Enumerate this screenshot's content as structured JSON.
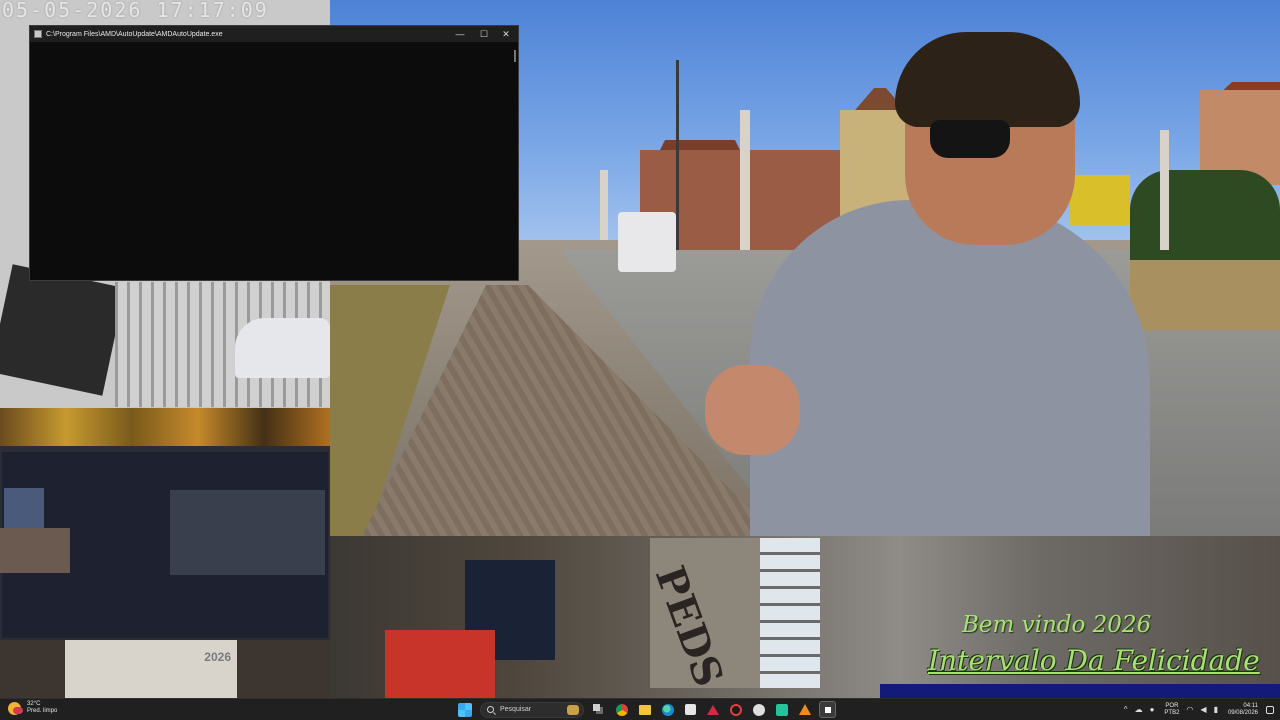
{
  "stream_overlay": {
    "timestamp": "05-05-2026  17:17:09",
    "caption_line1": "Bem vindo 2026",
    "caption_line2": "Intervalo Da Felicidade",
    "ticker": "",
    "calendar_year": "2026",
    "graffiti_text": "PEDS"
  },
  "console_window": {
    "title": "C:\\Program Files\\AMD\\AutoUpdate\\AMDAutoUpdate.exe",
    "minimize_glyph": "—",
    "maximize_glyph": "☐",
    "close_glyph": "✕"
  },
  "taskbar": {
    "weather": {
      "temperature": "32°C",
      "condition": "Pred. limpo"
    },
    "search_placeholder": "Pesquisar",
    "pinned_icons": [
      "start-icon",
      "search-icon",
      "task-view-icon",
      "chrome-icon",
      "file-explorer-icon",
      "edge-icon",
      "store-icon",
      "red-app-icon",
      "circle-app-icon",
      "gear-app-icon",
      "green-app-icon",
      "vlc-icon",
      "obs-icon"
    ],
    "tray": {
      "chevron": "^",
      "language": "POR",
      "keyboard": "PTB2",
      "time": "04:11",
      "date": "09/08/2026"
    }
  },
  "colors": {
    "caption": "#a9e073",
    "taskbar_bg": "#202020",
    "console_bg": "#0c0c0c"
  }
}
